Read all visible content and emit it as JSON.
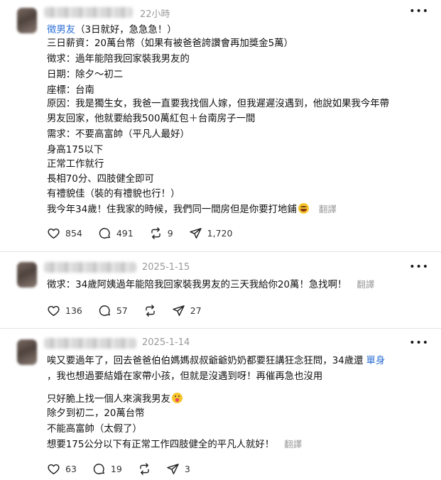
{
  "posts": [
    {
      "time": "22小時",
      "lines": [
        {
          "tag": "徵男友",
          "text": "（3日就好，急急急！）"
        },
        {
          "text": "三日薪資：20萬台幣（如果有被爸爸誇讚會再加獎金5萬）"
        },
        {
          "text": "徵求：過年能陪我回家裝我男友的"
        },
        {
          "text": "日期：除夕～初二"
        },
        {
          "text": "座標：台南"
        },
        {
          "text": "原因：我是獨生女，我爸一直要我找個人嫁，但我遲遲沒遇到，他說如果我今年帶"
        },
        {
          "text": "男友回家，他就要給我500萬紅包＋台南房子一間"
        },
        {
          "text": "需求：不要高富帥（平凡人最好）"
        },
        {
          "text": "身高175以下"
        },
        {
          "text": "正常工作就行"
        },
        {
          "text": "長相70分、四肢健全即可"
        },
        {
          "text": "有禮貌佳（裝的有禮貌也行！）"
        },
        {
          "text": "我今年34歲！住我家的時候，我們同一間房但是你要打地鋪",
          "emoji": "laughing-emoji",
          "translate": "翻譯"
        }
      ],
      "stats": {
        "likes": "854",
        "comments": "491",
        "reposts": "9",
        "shares": "1,720"
      }
    },
    {
      "time": "2025-1-15",
      "lines": [
        {
          "text": "徵求：34歲阿姨過年能陪我回家裝我男友的三天我給你20萬！急找啊！",
          "translate": "翻譯"
        }
      ],
      "stats": {
        "likes": "136",
        "comments": "57",
        "reposts": "",
        "shares": "27"
      }
    },
    {
      "time": "2025-1-14",
      "lines": [
        {
          "text": "唉又要過年了，回去爸爸伯伯媽媽叔叔爺爺奶奶都要狂講狂念狂問，34歲還",
          "tag_after": "單身"
        },
        {
          "text": "，我也想過要結婚在家帶小孩，但就是沒遇到呀！再催再急也沒用"
        },
        {
          "text": "只好脆上找一個人來演我男友",
          "emoji": "tongue-emoji"
        },
        {
          "text": "除夕到初二，20萬台幣"
        },
        {
          "text": "不能高富帥（太假了）"
        },
        {
          "text": "想要175公分以下有正常工作四肢健全的平凡人就好！",
          "translate": "翻譯"
        }
      ],
      "stats": {
        "likes": "63",
        "comments": "19",
        "reposts": "",
        "shares": "3"
      }
    }
  ]
}
